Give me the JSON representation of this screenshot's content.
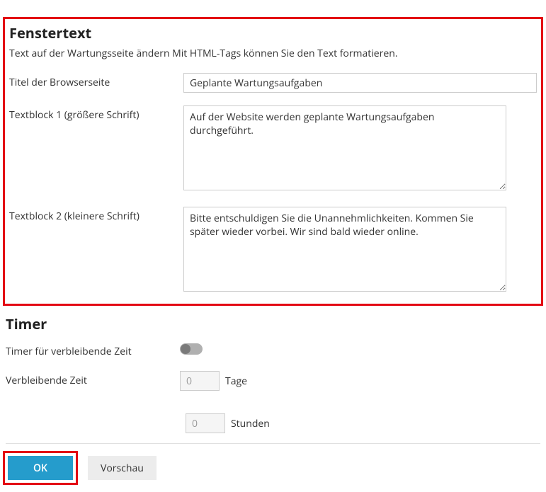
{
  "fenstertext": {
    "heading": "Fenstertext",
    "description": "Text auf der Wartungsseite ändern Mit HTML-Tags können Sie den Text formatieren.",
    "title_label": "Titel der Browserseite",
    "title_value": "Geplante Wartungsaufgaben",
    "block1_label": "Textblock 1 (größere Schrift)",
    "block1_value": "Auf der Website werden geplante Wartungsaufgaben durchgeführt.",
    "block2_label": "Textblock 2 (kleinere Schrift)",
    "block2_value": "Bitte entschuldigen Sie die Unannehmlichkeiten. Kommen Sie später wieder vorbei. Wir sind bald wieder online."
  },
  "timer": {
    "heading": "Timer",
    "toggle_label": "Timer für verbleibende Zeit",
    "toggle_state": false,
    "remaining_label": "Verbleibende Zeit",
    "days_value": "0",
    "days_unit": "Tage",
    "hours_value": "0",
    "hours_unit": "Stunden"
  },
  "buttons": {
    "ok": "OK",
    "preview": "Vorschau"
  }
}
